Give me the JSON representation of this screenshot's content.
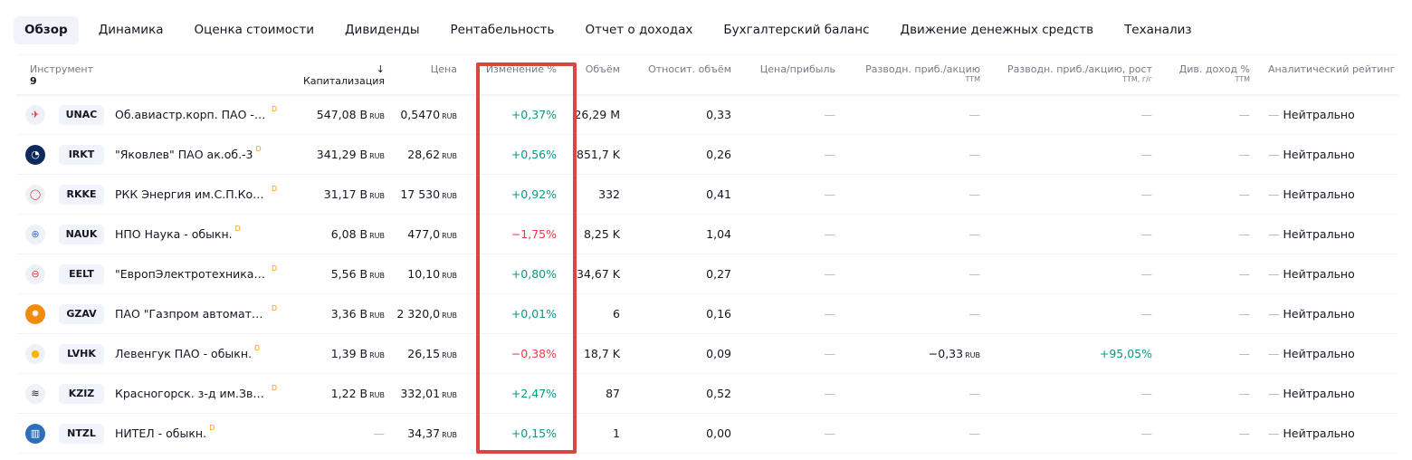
{
  "tabs": [
    "Обзор",
    "Динамика",
    "Оценка стоимости",
    "Дивиденды",
    "Рентабельность",
    "Отчет о доходах",
    "Бухгалтерский баланс",
    "Движение денежных средств",
    "Теханализ"
  ],
  "active_tab": 0,
  "columns": {
    "instrument": "Инструмент",
    "count": "9",
    "cap": "↓ Капитализация",
    "price": "Цена",
    "change": "Изменение %",
    "volume": "Объём",
    "relvol": "Относит. объём",
    "pe": "Цена/прибыль",
    "eps": "Разводн. приб./акцию",
    "eps_sub": "TTM",
    "epsg": "Разводн. приб./акцию, рост",
    "epsg_sub": "TTM, г/г",
    "div": "Див. доход %",
    "div_sub": "TTM",
    "rating": "Аналитический рейтинг"
  },
  "currency": "RUB",
  "dash": "—",
  "badge": "D",
  "rows": [
    {
      "ticker": "UNAC",
      "name": "Об.авиастр.корп. ПАО - об…",
      "cap": "547,08 B",
      "price": "0,5470",
      "change": "+0,37%",
      "dir": "pos",
      "volume": "26,29 M",
      "relvol": "0,33",
      "pe": "—",
      "eps": "—",
      "epsg": "—",
      "div": "—",
      "rating": "Нейтрально",
      "logo_bg": "#eef1f8",
      "logo_fg": "#d33",
      "logo": "✈"
    },
    {
      "ticker": "IRKT",
      "name": "\"Яковлев\" ПАО ак.об.-3",
      "cap": "341,29 B",
      "price": "28,62",
      "change": "+0,56%",
      "dir": "pos",
      "volume": "851,7 K",
      "relvol": "0,26",
      "pe": "—",
      "eps": "—",
      "epsg": "—",
      "div": "—",
      "rating": "Нейтрально",
      "logo_bg": "#0d2a5c",
      "logo_fg": "#fff",
      "logo": "◔"
    },
    {
      "ticker": "RKKE",
      "name": "РКК Энергия им.С.П.Коро…",
      "cap": "31,17 B",
      "price": "17 530",
      "change": "+0,92%",
      "dir": "pos",
      "volume": "332",
      "relvol": "0,41",
      "pe": "—",
      "eps": "—",
      "epsg": "—",
      "div": "—",
      "rating": "Нейтрально",
      "logo_bg": "#eef1f8",
      "logo_fg": "#e53935",
      "logo": "◯"
    },
    {
      "ticker": "NAUK",
      "name": "НПО Наука - обыкн.",
      "cap": "6,08 B",
      "price": "477,0",
      "change": "−1,75%",
      "dir": "neg",
      "volume": "8,25 K",
      "relvol": "1,04",
      "pe": "—",
      "eps": "—",
      "epsg": "—",
      "div": "—",
      "rating": "Нейтрально",
      "logo_bg": "#eef1f8",
      "logo_fg": "#3a7bd5",
      "logo": "⊕"
    },
    {
      "ticker": "EELT",
      "name": "\"ЕвропЭлектротехника\" ПА…",
      "cap": "5,56 B",
      "price": "10,10",
      "change": "+0,80%",
      "dir": "pos",
      "volume": "34,67 K",
      "relvol": "0,27",
      "pe": "—",
      "eps": "—",
      "epsg": "—",
      "div": "—",
      "rating": "Нейтрально",
      "logo_bg": "#eef1f8",
      "logo_fg": "#e53935",
      "logo": "⊖"
    },
    {
      "ticker": "GZAV",
      "name": "ПАО \"Газпром автоматизац…",
      "cap": "3,36 B",
      "price": "2 320,0",
      "change": "+0,01%",
      "dir": "pos",
      "volume": "6",
      "relvol": "0,16",
      "pe": "—",
      "eps": "—",
      "epsg": "—",
      "div": "—",
      "rating": "Нейтрально",
      "logo_bg": "#f28a0c",
      "logo_fg": "#fff",
      "logo": "✹"
    },
    {
      "ticker": "LVHK",
      "name": "Левенгук ПАО - обыкн.",
      "cap": "1,39 B",
      "price": "26,15",
      "change": "−0,38%",
      "dir": "neg",
      "volume": "18,7 K",
      "relvol": "0,09",
      "pe": "—",
      "eps": "−0,33",
      "eps_cur": true,
      "epsg": "+95,05%",
      "epsg_dir": "pos",
      "div": "—",
      "rating": "Нейтрально",
      "logo_bg": "#eef1f8",
      "logo_fg": "#f5b400",
      "logo": "●"
    },
    {
      "ticker": "KZIZ",
      "name": "Красногорск. з-д им.Звере…",
      "cap": "1,22 B",
      "price": "332,01",
      "change": "+2,47%",
      "dir": "pos",
      "volume": "87",
      "relvol": "0,52",
      "pe": "—",
      "eps": "—",
      "epsg": "—",
      "div": "—",
      "rating": "Нейтрально",
      "logo_bg": "#eef1f8",
      "logo_fg": "#222",
      "logo": "≋"
    },
    {
      "ticker": "NTZL",
      "name": "НИТЕЛ - обыкн.",
      "cap": "—",
      "price": "34,37",
      "change": "+0,15%",
      "dir": "pos",
      "volume": "1",
      "relvol": "0,00",
      "pe": "—",
      "eps": "—",
      "epsg": "—",
      "div": "—",
      "rating": "Нейтрально",
      "logo_bg": "#2f6fb8",
      "logo_fg": "#fff",
      "logo": "▥"
    }
  ],
  "colors": {
    "highlight": "#d9473f",
    "positive": "#089981",
    "negative": "#f23645"
  }
}
